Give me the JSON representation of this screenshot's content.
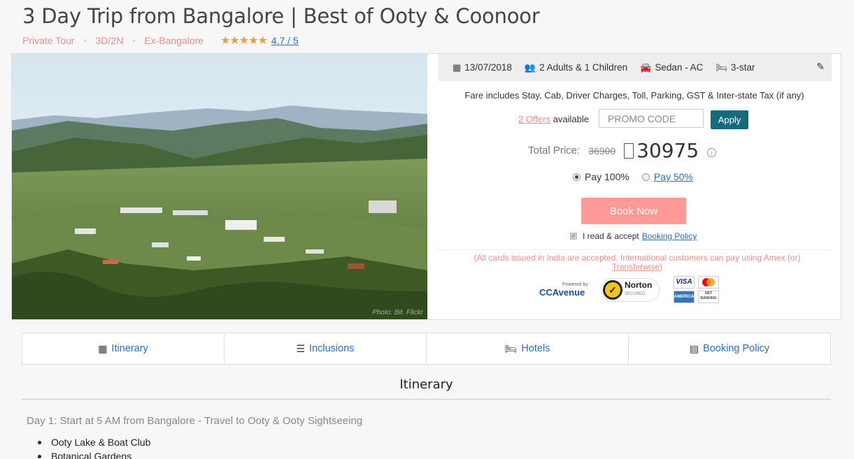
{
  "page": {
    "title": "3 Day Trip from Bangalore | Best of Ooty & Coonoor",
    "tags": [
      "Private Tour",
      "3D/2N",
      "Ex-Bangalore"
    ],
    "stars": "★★★★★",
    "rating": "4.7 / 5"
  },
  "photo": {
    "credit": "Photo: Bit. Flickr"
  },
  "trip": {
    "date": "13/07/2018",
    "guests": "2 Adults & 1 Children",
    "vehicle": "Sedan - AC",
    "hotel": "3-star"
  },
  "booking": {
    "fare_note": "Fare includes Stay, Cab, Driver Charges, Toll, Parking, GST & Inter-state Tax (if any)",
    "offers_link": "2 Offers",
    "offers_suffix": "available",
    "promo_placeholder": "PROMO CODE",
    "apply_label": "Apply",
    "total_label": "Total Price:",
    "old_price": "36900",
    "new_price": "30975",
    "pay_full": "Pay 100%",
    "pay_half": "Pay 50%",
    "pay_selected": "Pay 100%",
    "book_label": "Book Now",
    "accept_text": "I read & accept",
    "policy_link": "Booking Policy",
    "cards_note": "(All cards issued in India are accepted. International customers can pay using Amex (or)",
    "cards_link": "Transferwise",
    "cards_close": ")"
  },
  "logos": {
    "ccavenue_powered": "Powered by",
    "ccavenue": "CCAvenue",
    "norton": "Norton",
    "norton_sub": "SECURED",
    "visa": "VISA",
    "amex": "AMERICAN EXPRESS",
    "netbanking": "NET BANKING"
  },
  "tabs": [
    {
      "label": "Itinerary"
    },
    {
      "label": "Inclusions"
    },
    {
      "label": "Hotels"
    },
    {
      "label": "Booking Policy"
    }
  ],
  "itinerary": {
    "section_title": "Itinerary",
    "day1": "Day 1: Start at 5 AM from Bangalore - Travel to Ooty & Ooty Sightseeing",
    "day1_items": [
      "Ooty Lake & Boat Club",
      "Botanical Gardens"
    ]
  },
  "colors": {
    "accent_pink": "#f08b8b",
    "button_teal": "#156b7d",
    "book_button": "#ff9a96",
    "link_blue": "#2d6cb5"
  }
}
